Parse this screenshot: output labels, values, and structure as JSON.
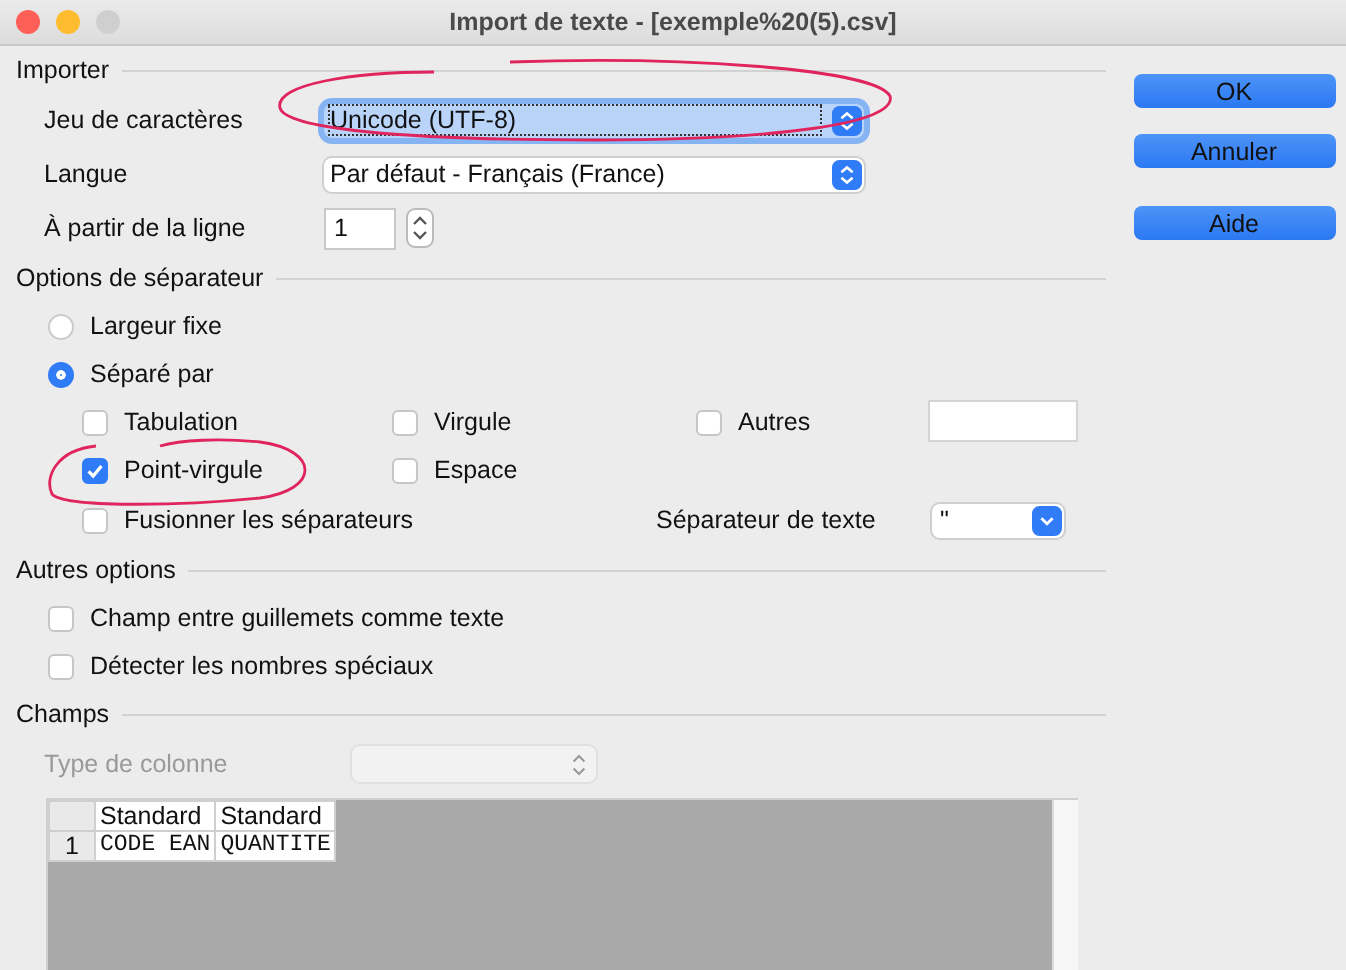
{
  "window": {
    "title": "Import de texte - [exemple%20(5).csv]"
  },
  "import": {
    "heading": "Importer",
    "charset": {
      "label": "Jeu de caractères",
      "value": "Unicode (UTF-8)",
      "focused": true
    },
    "language": {
      "label": "Langue",
      "value": "Par défaut - Français (France)",
      "focused": false
    },
    "from_row": {
      "label": "À partir de la ligne",
      "value": "1"
    }
  },
  "separator_options": {
    "heading": "Options de séparateur",
    "modes": [
      {
        "label": "Largeur fixe",
        "selected": false
      },
      {
        "label": "Séparé par",
        "selected": true
      }
    ],
    "separators": [
      {
        "label": "Tabulation",
        "checked": false
      },
      {
        "label": "Virgule",
        "checked": false
      },
      {
        "label": "Autres",
        "checked": false
      },
      {
        "label": "Point-virgule",
        "checked": true
      },
      {
        "label": "Espace",
        "checked": false
      }
    ],
    "merge": {
      "label": "Fusionner les séparateurs",
      "checked": false
    },
    "text_separator": {
      "label": "Séparateur de texte",
      "value": "\""
    }
  },
  "other_options": {
    "heading": "Autres options",
    "items": [
      {
        "label": "Champ entre guillemets comme texte",
        "checked": false
      },
      {
        "label": "Détecter les nombres spéciaux",
        "checked": false
      }
    ]
  },
  "fields": {
    "heading": "Champs",
    "column_type": {
      "label": "Type de colonne",
      "disabled": true
    },
    "table": {
      "columns": [
        "Standard",
        "Standard"
      ],
      "rows": [
        {
          "number": "1",
          "cells": [
            "CODE EAN",
            "QUANTITE"
          ]
        }
      ]
    }
  },
  "buttons": [
    "OK",
    "Annuler",
    "Aide"
  ]
}
